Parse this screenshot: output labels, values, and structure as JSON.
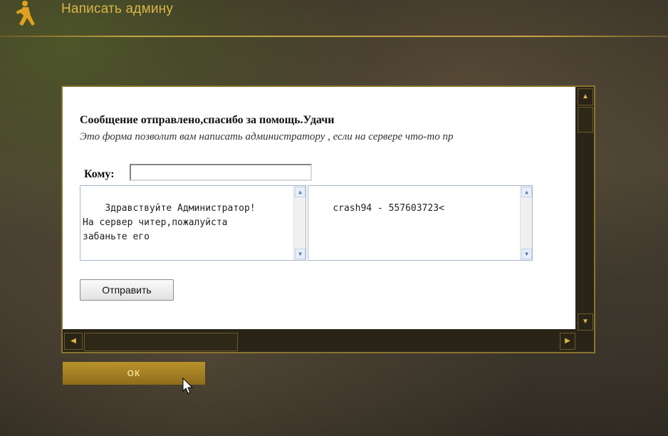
{
  "window": {
    "title": "Написать админу",
    "logo_icon": "counter-strike-logo-icon",
    "accent": "#d9b44a"
  },
  "page": {
    "heading": "Сообщение отправлено,спасибо за помощь.Удачи",
    "subheading": "Это форма позволит вам написать администратору , если на сервере что-то пр",
    "to_label": "Кому:",
    "to_value": "",
    "message_text": "Здравствуйте Администратор!\nНа сервер читер,пожалуйста\nзабаньте его",
    "info_text": "crash94 - 557603723<",
    "send_button_label": "Отправить"
  },
  "dialog": {
    "ok_button_label": "ОК"
  }
}
